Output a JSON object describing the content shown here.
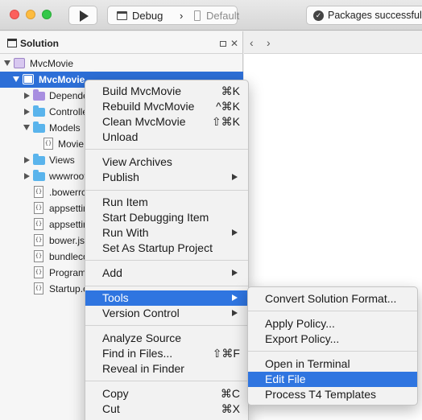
{
  "toolbar": {
    "configuration": "Debug",
    "separator": "›",
    "device": "Default",
    "status_message": "Packages successfully"
  },
  "solution_pad": {
    "title": "Solution",
    "tree": [
      {
        "label": "MvcMovie",
        "kind": "solution",
        "expanded": true
      },
      {
        "label": "MvcMovie",
        "kind": "project",
        "expanded": true,
        "selected": true
      },
      {
        "label": "Dependencies",
        "kind": "folder-purple"
      },
      {
        "label": "Controllers",
        "kind": "folder"
      },
      {
        "label": "Models",
        "kind": "folder",
        "expanded": true
      },
      {
        "label": "Movie.cs",
        "kind": "file"
      },
      {
        "label": "Views",
        "kind": "folder"
      },
      {
        "label": "wwwroot",
        "kind": "folder"
      },
      {
        "label": ".bowerrc",
        "kind": "file"
      },
      {
        "label": "appsettings.Development.json",
        "kind": "file"
      },
      {
        "label": "appsettings.json",
        "kind": "file"
      },
      {
        "label": "bower.json",
        "kind": "file"
      },
      {
        "label": "bundleconfig.json",
        "kind": "file"
      },
      {
        "label": "Program.cs",
        "kind": "file"
      },
      {
        "label": "Startup.cs",
        "kind": "file"
      }
    ]
  },
  "editor": {
    "back": "‹",
    "forward": "›"
  },
  "context_menu": {
    "items": [
      {
        "label": "Build MvcMovie",
        "shortcut": "⌘K"
      },
      {
        "label": "Rebuild MvcMovie",
        "shortcut": "^⌘K"
      },
      {
        "label": "Clean MvcMovie",
        "shortcut": "⇧⌘K"
      },
      {
        "label": "Unload",
        "shortcut": ""
      },
      {
        "label": "View Archives",
        "shortcut": ""
      },
      {
        "label": "Publish",
        "shortcut": ""
      },
      {
        "label": "Run Item",
        "shortcut": ""
      },
      {
        "label": "Start Debugging Item",
        "shortcut": ""
      },
      {
        "label": "Run With",
        "shortcut": ""
      },
      {
        "label": "Set As Startup Project",
        "shortcut": ""
      },
      {
        "label": "Add",
        "shortcut": ""
      },
      {
        "label": "Tools",
        "shortcut": ""
      },
      {
        "label": "Version Control",
        "shortcut": ""
      },
      {
        "label": "Analyze Source",
        "shortcut": ""
      },
      {
        "label": "Find in Files...",
        "shortcut": "⇧⌘F"
      },
      {
        "label": "Reveal in Finder",
        "shortcut": ""
      },
      {
        "label": "Copy",
        "shortcut": "⌘C"
      },
      {
        "label": "Cut",
        "shortcut": "⌘X"
      }
    ]
  },
  "tools_submenu": {
    "items": [
      {
        "label": "Convert Solution Format..."
      },
      {
        "label": "Apply Policy..."
      },
      {
        "label": "Export Policy..."
      },
      {
        "label": "Open in Terminal"
      },
      {
        "label": "Edit File"
      },
      {
        "label": "Process T4 Templates"
      }
    ]
  },
  "colors": {
    "selection": "#2d6fd7",
    "menu_highlight": "#2f75e0",
    "folder": "#5ab4ec"
  }
}
